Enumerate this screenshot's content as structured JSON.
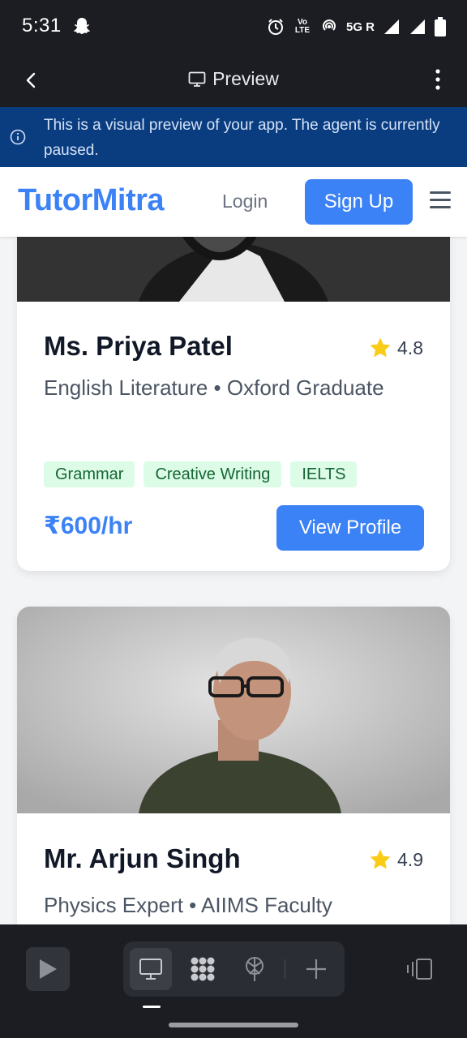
{
  "status_bar": {
    "time": "5:31",
    "network_volte": "Vo LTE",
    "network_type": "5G R"
  },
  "app_bar": {
    "title": "Preview"
  },
  "banner": {
    "message": "This is a visual preview of your app. The agent is currently paused."
  },
  "site": {
    "brand": "TutorMitra",
    "login_label": "Login",
    "signup_label": "Sign Up"
  },
  "tutors": [
    {
      "name": "Ms. Priya Patel",
      "rating": "4.8",
      "subtitle": "English Literature • Oxford Graduate",
      "tags": [
        "Grammar",
        "Creative Writing",
        "IELTS"
      ],
      "price": "₹600/hr",
      "button_label": "View Profile"
    },
    {
      "name": "Mr. Arjun Singh",
      "rating": "4.9",
      "subtitle": "Physics Expert • AIIMS Faculty"
    }
  ],
  "colors": {
    "brand": "#3b82f6",
    "tag_bg": "#dcfce7",
    "tag_text": "#166534",
    "banner_bg": "#0a3c80",
    "star": "#facc15"
  },
  "toolbar": {
    "icons": [
      "play-icon",
      "desktop-icon",
      "grid-icon",
      "network-tree-icon",
      "plus-icon",
      "split-view-icon"
    ]
  }
}
